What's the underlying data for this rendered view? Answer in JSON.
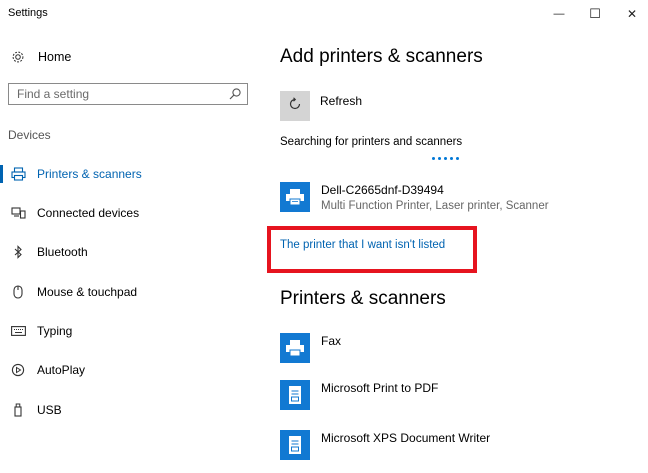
{
  "window": {
    "title": "Settings",
    "minimize_glyph": "—",
    "maximize_glyph": "☐",
    "close_glyph": "✕"
  },
  "sidebar": {
    "home_label": "Home",
    "search_placeholder": "Find a setting",
    "section_title": "Devices",
    "items": [
      {
        "label": "Printers & scanners",
        "icon": "printer-icon",
        "active": true
      },
      {
        "label": "Connected devices",
        "icon": "connected-devices-icon",
        "active": false
      },
      {
        "label": "Bluetooth",
        "icon": "bluetooth-icon",
        "active": false
      },
      {
        "label": "Mouse & touchpad",
        "icon": "mouse-icon",
        "active": false
      },
      {
        "label": "Typing",
        "icon": "keyboard-icon",
        "active": false
      },
      {
        "label": "AutoPlay",
        "icon": "autoplay-icon",
        "active": false
      },
      {
        "label": "USB",
        "icon": "usb-icon",
        "active": false
      }
    ]
  },
  "main": {
    "add_title": "Add printers & scanners",
    "refresh_label": "Refresh",
    "searching_text": "Searching for printers and scanners",
    "found_devices": [
      {
        "name": "Dell-C2665dnf-D39494",
        "description": "Multi Function Printer, Laser printer, Scanner"
      }
    ],
    "not_listed_link": "The printer that I want isn't listed",
    "printers_title": "Printers & scanners",
    "printers": [
      {
        "name": "Fax",
        "icon": "fax-printer-icon"
      },
      {
        "name": "Microsoft Print to PDF",
        "icon": "document-printer-icon"
      },
      {
        "name": "Microsoft XPS Document Writer",
        "icon": "document-printer-icon"
      }
    ]
  },
  "colors": {
    "accent": "#0063b1",
    "printer_tile": "#1279d2",
    "highlight_box": "#e6141f"
  }
}
